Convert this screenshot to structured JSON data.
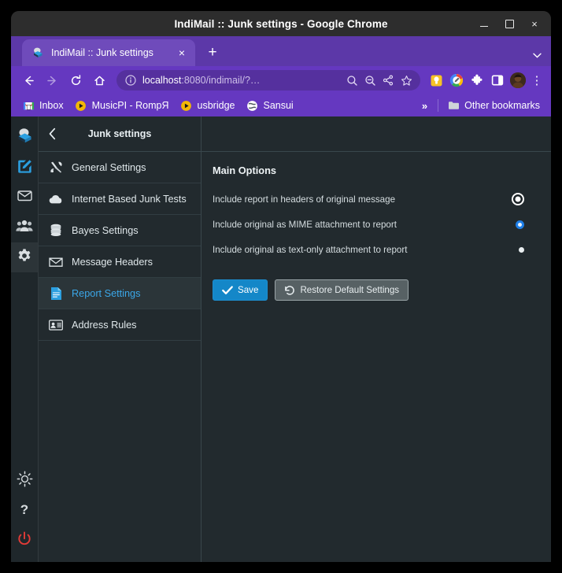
{
  "window": {
    "title": "IndiMail :: Junk settings - Google Chrome",
    "controls": {
      "minimize": "minimize-button",
      "maximize": "maximize-button",
      "close": "×"
    }
  },
  "tabstrip": {
    "tabs": [
      {
        "title": "IndiMail :: Junk settings",
        "favicon": "indimail-cube-icon",
        "close": "×"
      }
    ],
    "new_tab": "+",
    "tab_list_chevron": "⌄"
  },
  "toolbar": {
    "back": "←",
    "forward": "→",
    "reload": "⟳",
    "home": "⌂",
    "omnibox": {
      "info_icon": "site-info-icon",
      "url_host": "localhost",
      "url_path": ":8080/indimail/?…",
      "zoom_in_icon": "zoom-in-icon",
      "zoom_out_icon": "zoom-out-icon",
      "share_icon": "share-icon",
      "bookmark_star_icon": "star-icon"
    },
    "extensions": [
      {
        "name": "keep-notes-extension",
        "color": "#f7c325"
      },
      {
        "name": "google-editor-extension",
        "color": "#ffffff"
      },
      {
        "name": "extensions-puzzle-icon",
        "color": "#ffffff"
      },
      {
        "name": "side-panel-icon",
        "color": "#ffffff"
      }
    ],
    "profile_avatar": "profile-avatar",
    "menu": "⋮"
  },
  "bookmarks": {
    "items": [
      {
        "label": "Inbox",
        "icon": "gmail-icon"
      },
      {
        "label": "MusicPI - RompЯ",
        "icon": "play-circle-icon"
      },
      {
        "label": "usbridge",
        "icon": "play-circle-icon"
      },
      {
        "label": "Sansui",
        "icon": "globe-icon"
      }
    ],
    "overflow": "»",
    "other_bookmarks": "Other bookmarks",
    "other_bookmarks_icon": "folder-icon"
  },
  "rail": {
    "items": [
      {
        "name": "indimail-logo",
        "icon": "cube-logo-icon",
        "active": false
      },
      {
        "name": "compose",
        "icon": "compose-icon",
        "active": false
      },
      {
        "name": "mail",
        "icon": "envelope-icon",
        "active": false
      },
      {
        "name": "contacts",
        "icon": "people-icon",
        "active": false
      },
      {
        "name": "settings",
        "icon": "gear-icon",
        "active": true
      }
    ],
    "bottom_items": [
      {
        "name": "theme",
        "icon": "brightness-icon"
      },
      {
        "name": "help",
        "icon": "question-mark-icon"
      },
      {
        "name": "logout",
        "icon": "power-icon"
      }
    ]
  },
  "settings_list": {
    "back_label": "‹",
    "title": "Junk settings",
    "items": [
      {
        "label": "General Settings",
        "icon": "tools-icon",
        "selected": false
      },
      {
        "label": "Internet Based Junk Tests",
        "icon": "cloud-icon",
        "selected": false
      },
      {
        "label": "Bayes Settings",
        "icon": "database-icon",
        "selected": false
      },
      {
        "label": "Message Headers",
        "icon": "envelope-icon",
        "selected": false
      },
      {
        "label": "Report Settings",
        "icon": "document-icon",
        "selected": true
      },
      {
        "label": "Address Rules",
        "icon": "contact-card-icon",
        "selected": false
      }
    ]
  },
  "main": {
    "section_title": "Main Options",
    "options": [
      {
        "label": "Include report in headers of original message",
        "state": "focused-selected"
      },
      {
        "label": "Include original as MIME attachment to report",
        "state": "blue"
      },
      {
        "label": "Include original as text-only attachment to report",
        "state": "plain"
      }
    ],
    "buttons": [
      {
        "label": "Save",
        "icon": "check-icon",
        "style": "primary"
      },
      {
        "label": "Restore Default Settings",
        "icon": "undo-icon",
        "style": "secondary"
      }
    ]
  },
  "colors": {
    "chrome_purple": "#6538c0",
    "tab_purple": "#6f4bbb",
    "page_bg": "#222a2e",
    "accent_blue": "#3ba7e8",
    "primary_button": "#1487c8",
    "power_red": "#e23b37"
  }
}
